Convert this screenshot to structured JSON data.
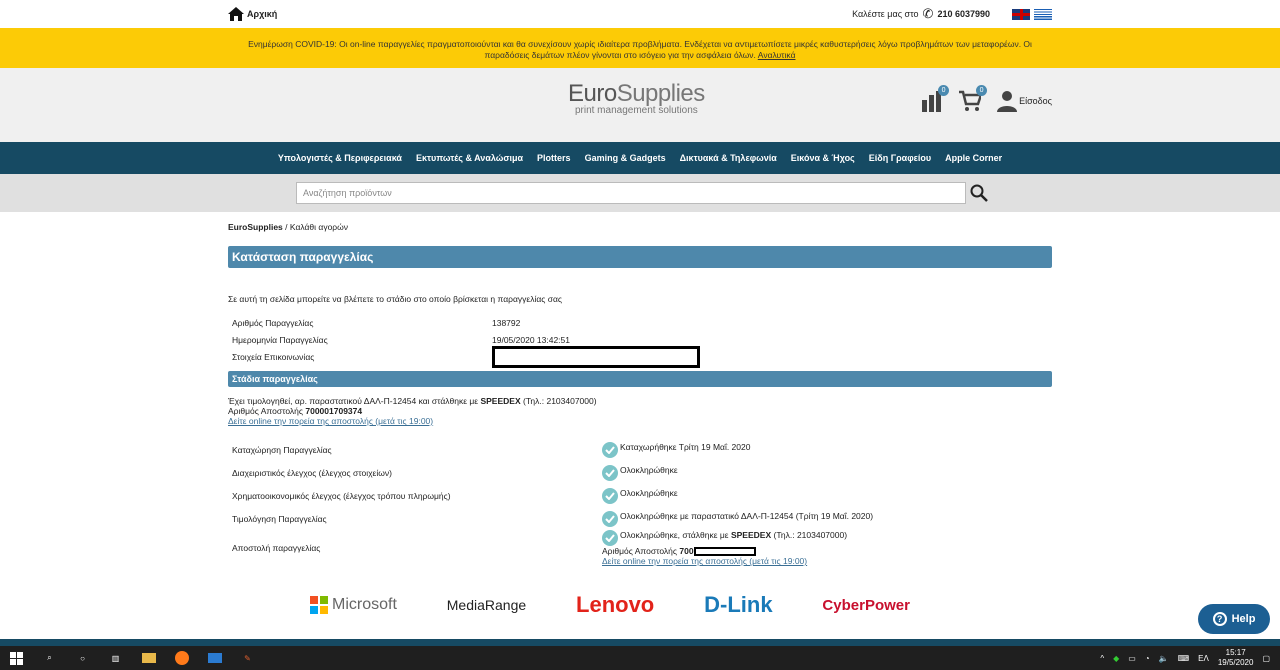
{
  "topbar": {
    "home": "Αρχική",
    "call_label": "Καλέστε μας στο",
    "phone": "210 6037990"
  },
  "covid": {
    "text": "Ενημέρωση COVID-19: Οι on-line παραγγελίες πραγματοποιούνται και θα συνεχίσουν χωρίς ιδιαίτερα προβλήματα. Ενδέχεται να αντιμετωπίσετε μικρές καθυστερήσεις λόγω προβλημάτων των μεταφορέων. Οι παραδόσεις δεμάτων πλέον γίνονται στο ισόγειο για την ασφάλεια όλων.",
    "link": "Αναλυτικά"
  },
  "header": {
    "logo_main": "EuroSupplies",
    "logo_sub": "print management solutions",
    "compare_count": "0",
    "cart_count": "0",
    "login": "Είσοδος"
  },
  "nav": [
    "Υπολογιστές & Περιφερειακά",
    "Εκτυπωτές & Αναλώσιμα",
    "Plotters",
    "Gaming & Gadgets",
    "Δικτυακά & Τηλεφωνία",
    "Εικόνα & Ήχος",
    "Είδη Γραφείου",
    "Apple Corner"
  ],
  "search": {
    "placeholder": "Αναζήτηση προϊόντων"
  },
  "breadcrumb": {
    "home": "EuroSupplies",
    "sep": "/",
    "current": "Καλάθι αγορών"
  },
  "page": {
    "title": "Κατάσταση παραγγελίας",
    "intro": "Σε αυτή τη σελίδα μπορείτε να βλέπετε το στάδιο στο οποίο βρίσκεται η παραγγελίας σας",
    "info": [
      {
        "k": "Αριθμός Παραγγελίας",
        "v": "138792"
      },
      {
        "k": "Ημερομηνία Παραγγελίας",
        "v": "19/05/2020 13:42:51"
      },
      {
        "k": "Στοιχεία Επικοινωνίας",
        "v": ""
      }
    ],
    "stages_title": "Στάδια παραγγελίας",
    "ship_pre": "Έχει τιμολογηθεί, αρ. παραστατικού ΔΑΛ-Π-12454 και στάλθηκε με",
    "ship_courier": "SPEEDEX",
    "ship_post": "(Τηλ.: 2103407000)",
    "tracking_label": "Αριθμός Αποστολής",
    "tracking": "700001709374",
    "track_link": "Δείτε online την πορεία της αποστολής (μετά τις 19:00)",
    "stages": [
      {
        "k": "Καταχώρηση Παραγγελίας",
        "v": "Καταχωρήθηκε Τρίτη 19 Μαΐ. 2020"
      },
      {
        "k": "Διαχειριστικός έλεγχος (έλεγχος στοιχείων)",
        "v": "Ολοκληρώθηκε"
      },
      {
        "k": "Χρηματοοικονομικός έλεγχος (έλεγχος τρόπου πληρωμής)",
        "v": "Ολοκληρώθηκε"
      },
      {
        "k": "Τιμολόγηση Παραγγελίας",
        "v": "Ολοκληρώθηκε με παραστατικό ΔΑΛ-Π-12454 (Τρίτη 19 Μαΐ. 2020)"
      },
      {
        "k": "Αποστολή παραγγελίας",
        "v": "Ολοκληρώθηκε, στάλθηκε με"
      }
    ],
    "last_courier": "SPEEDEX",
    "last_phone": "(Τηλ.: 2103407000)",
    "last_tracking_prefix": "700"
  },
  "brands": [
    "Microsoft",
    "MediaRange",
    "Lenovo",
    "D-Link",
    "CyberPower"
  ],
  "help": "Help",
  "taskbar": {
    "lang": "ΕΛ",
    "time": "15:17",
    "date": "19/5/2020"
  },
  "colors": {
    "accent": "#4e88ab",
    "nav": "#164a63",
    "banner": "#fccb06"
  }
}
